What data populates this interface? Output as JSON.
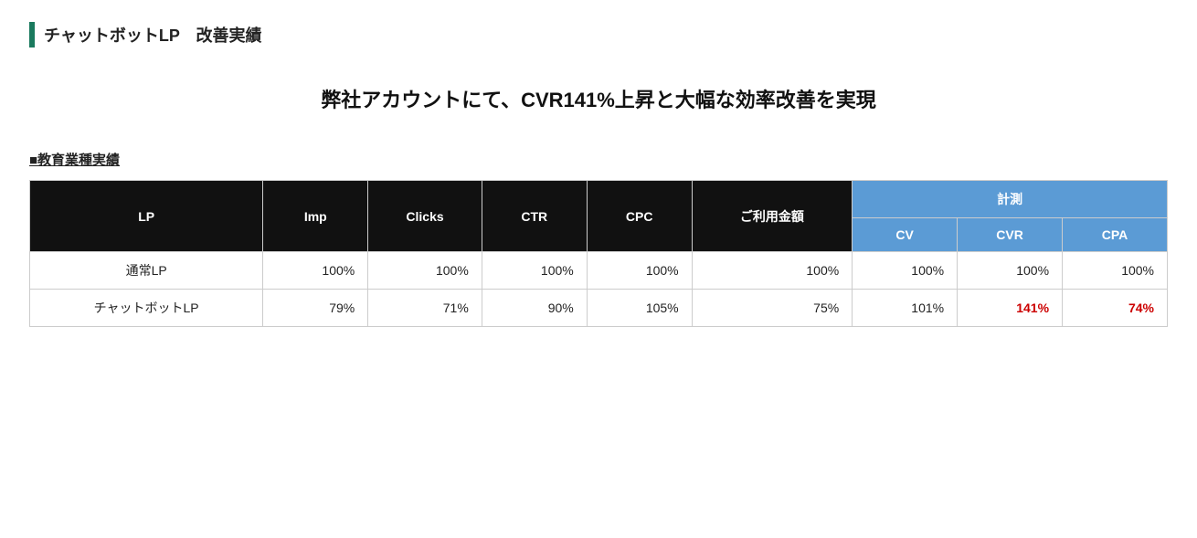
{
  "header": {
    "bar_color": "#1a7a5e",
    "title": "チャットボットLP　改善実績"
  },
  "headline": "弊社アカウントにて、CVR141%上昇と大幅な効率改善を実現",
  "section_title": "■教育業種実績",
  "table": {
    "col_headers": {
      "lp": "LP",
      "imp": "Imp",
      "clicks": "Clicks",
      "ctr": "CTR",
      "cpc": "CPC",
      "usage": "ご利用金額",
      "keisoku": "計測",
      "cv": "CV",
      "cvr": "CVR",
      "cpa": "CPA"
    },
    "rows": [
      {
        "lp": "通常LP",
        "imp": "100%",
        "clicks": "100%",
        "ctr": "100%",
        "cpc": "100%",
        "usage": "100%",
        "cv": "100%",
        "cvr": "100%",
        "cpa": "100%",
        "cvr_highlight": false,
        "cpa_highlight": false
      },
      {
        "lp": "チャットボットLP",
        "imp": "79%",
        "clicks": "71%",
        "ctr": "90%",
        "cpc": "105%",
        "usage": "75%",
        "cv": "101%",
        "cvr": "141%",
        "cpa": "74%",
        "cvr_highlight": true,
        "cpa_highlight": true
      }
    ]
  }
}
